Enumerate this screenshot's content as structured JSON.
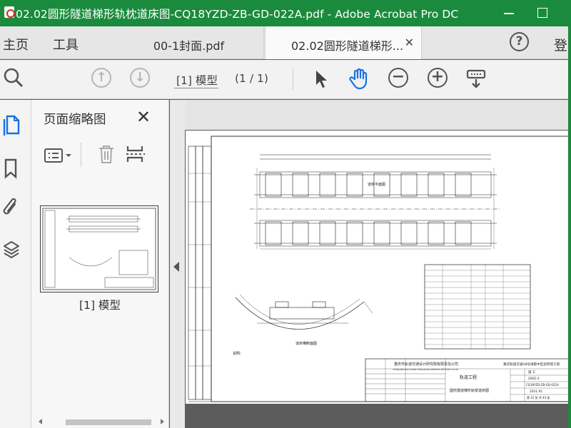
{
  "titlebar": {
    "title": "02.02圆形隧道梯形轨枕道床图-CQ18YZD-ZB-GD-022A.pdf - Adobe Acrobat Pro DC"
  },
  "tabs": {
    "home": "主页",
    "tools": "工具",
    "items": [
      {
        "label": "00-1封面.pdf"
      },
      {
        "label": "02.02圆形隧道梯形...",
        "close": "✕"
      }
    ],
    "help": "?",
    "login": "登"
  },
  "toolbar": {
    "page_name": "[1] 模型",
    "page_count": "(1 / 1)"
  },
  "thumbnails": {
    "title": "页面缩略图",
    "close": "✕",
    "items": [
      {
        "label": "[1] 模型"
      }
    ]
  },
  "drawing": {
    "company": "重庆市轨道交通设计研究院有限责任公司",
    "company_en": "CHONGQING RAIL TRANSIT DESIGN AND RESEARCH INSTITUTE CO.,LTD",
    "project": "重庆轨道交通18号线歇中区段所管工程",
    "discipline": "轨道工程",
    "drawing_title": "圆形隧道梯形轨枕道床图",
    "drawing_no": "CQ18YZD-ZB-GD-022A",
    "date": "2021.01",
    "stage": "施 工",
    "version": "2002-3",
    "sheets": "第 22 张   共 43 张",
    "plan_caption": "道床平面图",
    "section_caption": "道床横断面图",
    "notes_title": "说明："
  },
  "colors": {
    "titlebar": "#1a8b3d",
    "accent_blue": "#1473e6"
  }
}
